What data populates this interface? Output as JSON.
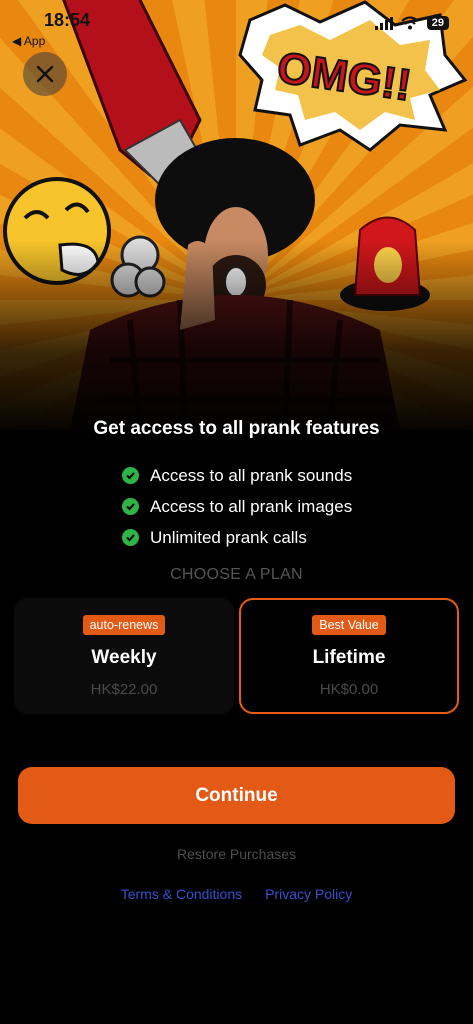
{
  "status_bar": {
    "time": "18:54",
    "back_label": "◀ App",
    "battery": "29"
  },
  "hero": {
    "burst_text": "OMG!!"
  },
  "headline": "Get access to all prank features",
  "features": [
    "Access to all prank sounds",
    "Access to all prank images",
    "Unlimited prank calls"
  ],
  "choose_label": "CHOOSE A PLAN",
  "plans": [
    {
      "badge": "auto-renews",
      "name": "Weekly",
      "price": "HK$22.00",
      "selected": false
    },
    {
      "badge": "Best Value",
      "name": "Lifetime",
      "price": "HK$0.00",
      "selected": true
    }
  ],
  "continue_label": "Continue",
  "restore_label": "Restore Purchases",
  "links": {
    "terms": "Terms & Conditions",
    "privacy": "Privacy Policy"
  },
  "colors": {
    "accent": "#e35a17",
    "check": "#2fb344",
    "link": "#3a4ed0",
    "hero_bg": "#f0a020"
  },
  "icons": [
    "close-icon",
    "check-icon",
    "signal-icon",
    "wifi-icon",
    "battery-icon"
  ]
}
